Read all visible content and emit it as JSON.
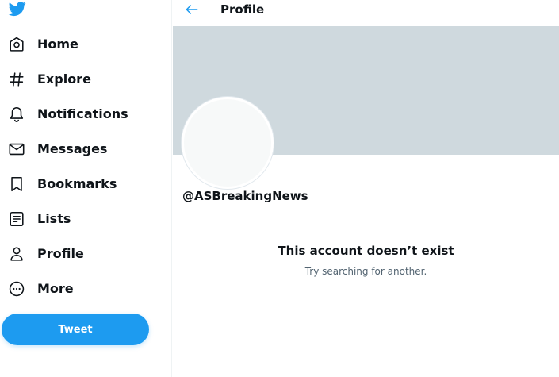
{
  "sidebar": {
    "logo_icon": "twitter-bird-icon",
    "items": [
      {
        "label": "Home",
        "icon": "home-icon"
      },
      {
        "label": "Explore",
        "icon": "hashtag-icon"
      },
      {
        "label": "Notifications",
        "icon": "bell-icon"
      },
      {
        "label": "Messages",
        "icon": "envelope-icon"
      },
      {
        "label": "Bookmarks",
        "icon": "bookmark-icon"
      },
      {
        "label": "Lists",
        "icon": "list-icon"
      },
      {
        "label": "Profile",
        "icon": "person-icon"
      },
      {
        "label": "More",
        "icon": "more-circle-icon"
      }
    ],
    "tweet_label": "Tweet"
  },
  "header": {
    "title": "Profile",
    "back_icon": "back-arrow-icon"
  },
  "profile": {
    "handle": "@ASBreakingNews"
  },
  "empty_state": {
    "title": "This account doesn’t exist",
    "subtitle": "Try searching for another."
  },
  "colors": {
    "accent": "#1d9bf0",
    "banner": "#cfd9de",
    "text_primary": "#0f1419",
    "text_secondary": "#536471"
  }
}
